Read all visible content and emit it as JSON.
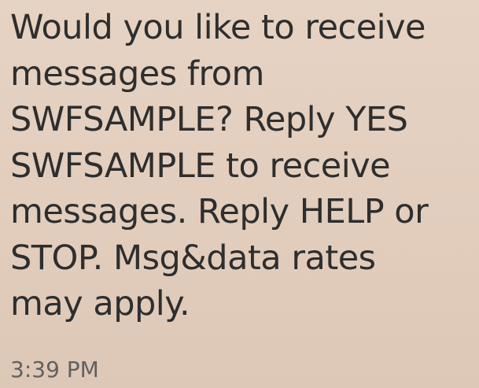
{
  "message": {
    "lines": [
      "Would you like to receive",
      "messages from",
      "SWFSAMPLE? Reply YES",
      "SWFSAMPLE to receive",
      "messages. Reply HELP or",
      "STOP. Msg&data rates",
      "may apply."
    ],
    "timestamp": "3:39 PM"
  },
  "colors": {
    "bubble_background": "#e3cfbf",
    "message_text": "#2e2e2e",
    "timestamp_text": "#616161"
  }
}
